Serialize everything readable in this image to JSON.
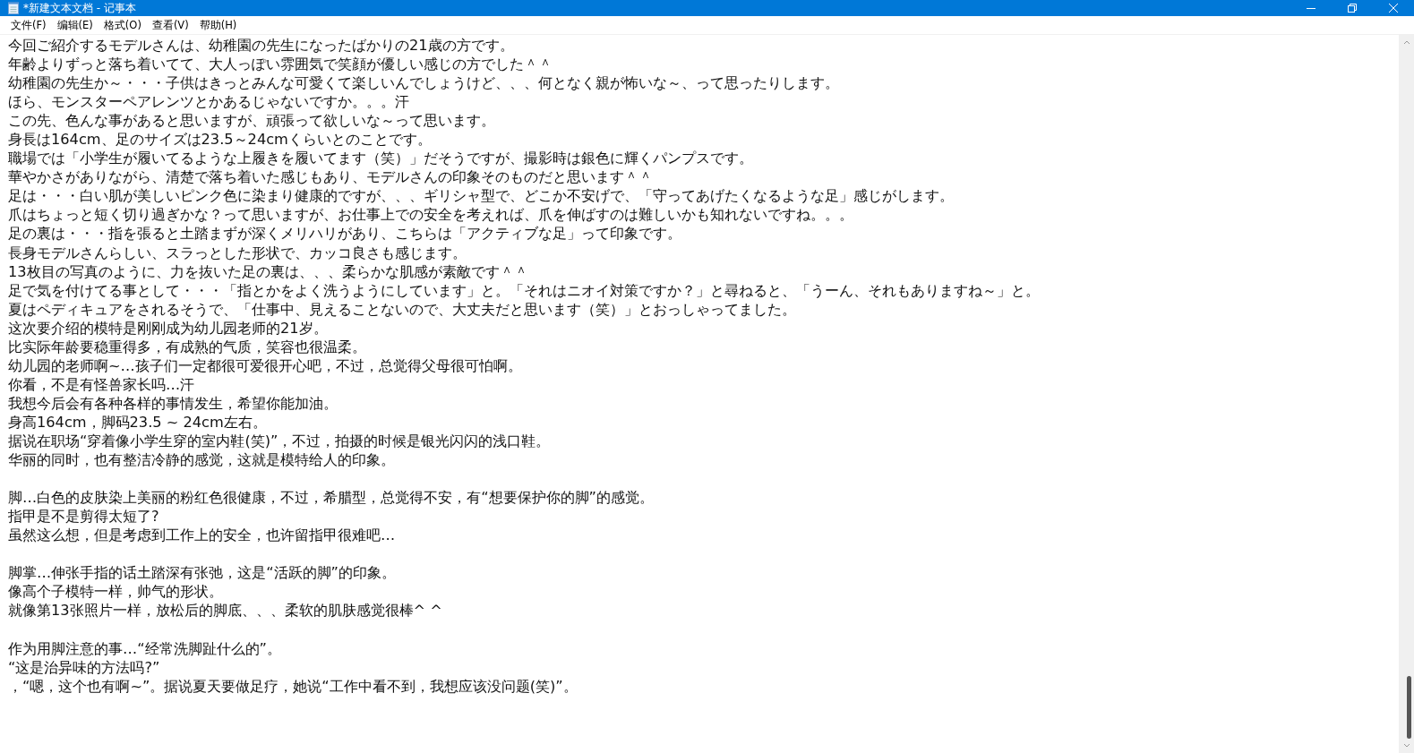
{
  "window": {
    "title": "*新建文本文档 - 记事本"
  },
  "menu": [
    {
      "label": "文件(F)"
    },
    {
      "label": "编辑(E)"
    },
    {
      "label": "格式(O)"
    },
    {
      "label": "查看(V)"
    },
    {
      "label": "帮助(H)"
    }
  ],
  "paragraphs": [
    {
      "lines": [
        "今回ご紹介するモデルさんは、幼稚園の先生になったばかりの21歳の方です。",
        "年齢よりずっと落ち着いてて、大人っぽい雰囲気で笑顔が優しい感じの方でした＾＾",
        "幼稚園の先生か～・・・子供はきっとみんな可愛くて楽しいんでしょうけど、、、何となく親が怖いな～、って思ったりします。",
        "ほら、モンスターペアレンツとかあるじゃないですか。。。汗",
        "この先、色んな事があると思いますが、頑張って欲しいな～って思います。",
        "身長は164cm、足のサイズは23.5～24cmくらいとのことです。",
        "職場では「小学生が履いてるような上履きを履いてます（笑）」だそうですが、撮影時は銀色に輝くパンプスです。",
        "華やかさがありながら、清楚で落ち着いた感じもあり、モデルさんの印象そのものだと思います＾＾",
        "足は・・・白い肌が美しいピンク色に染まり健康的ですが、、、ギリシャ型で、どこか不安げで、「守ってあげたくなるような足」感じがします。",
        "爪はちょっと短く切り過ぎかな？って思いますが、お仕事上での安全を考えれば、爪を伸ばすのは難しいかも知れないですね。。。",
        "足の裏は・・・指を張ると土踏まずが深くメリハリがあり、こちらは「アクティブな足」って印象です。",
        "長身モデルさんらしい、スラっとした形状で、カッコ良さも感じます。",
        "13枚目の写真のように、力を抜いた足の裏は、、、柔らかな肌感が素敵です＾＾",
        "足で気を付けてる事として・・・「指とかをよく洗うようにしています」と。「それはニオイ対策ですか？」と尋ねると、「うーん、それもありますね～」と。",
        "夏はペディキュアをされるそうで、「仕事中、見えることないので、大丈夫だと思います（笑）」とおっしゃってました。",
        "这次要介绍的模特是刚刚成为幼儿园老师的21岁。",
        "比实际年龄要稳重得多，有成熟的气质，笑容也很温柔。",
        "幼儿园的老师啊~…孩子们一定都很可爱很开心吧，不过，总觉得父母很可怕啊。",
        "你看，不是有怪兽家长吗…汗",
        "我想今后会有各种各样的事情发生，希望你能加油。",
        "身高164cm，脚码23.5 ~ 24cm左右。",
        "据说在职场“穿着像小学生穿的室内鞋(笑)”，不过，拍摄的时候是银光闪闪的浅口鞋。",
        "华丽的同时，也有整洁冷静的感觉，这就是模特给人的印象。"
      ]
    },
    {
      "lines": [
        "脚…白色的皮肤染上美丽的粉红色很健康，不过，希腊型，总觉得不安，有“想要保护你的脚”的感觉。",
        "指甲是不是剪得太短了?",
        "虽然这么想，但是考虑到工作上的安全，也许留指甲很难吧…"
      ]
    },
    {
      "lines": [
        "脚掌…伸张手指的话土踏深有张弛，这是“活跃的脚”的印象。",
        "像高个子模特一样，帅气的形状。",
        "就像第13张照片一样，放松后的脚底、、、柔软的肌肤感觉很棒^ ^"
      ]
    },
    {
      "lines": [
        "作为用脚注意的事…“经常洗脚趾什么的”。",
        "“这是治异味的方法吗?”",
        "，“嗯，这个也有啊~”。据说夏天要做足疗，她说“工作中看不到，我想应该没问题(笑)”。"
      ]
    }
  ]
}
